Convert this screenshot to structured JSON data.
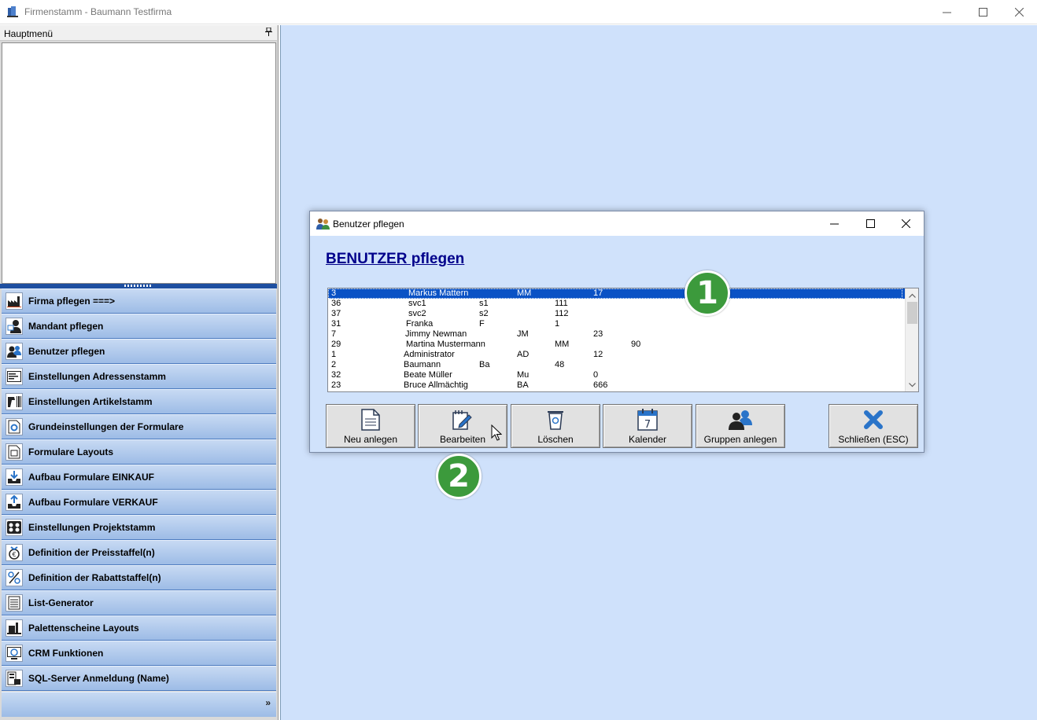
{
  "window": {
    "title": "Firmenstamm - Baumann Testfirma"
  },
  "left_panel": {
    "header": "Hauptmenü",
    "pin_glyph": "📌",
    "items": [
      {
        "label": "Firma pflegen   ===>",
        "icon": "factory-icon"
      },
      {
        "label": "Mandant pflegen",
        "icon": "person-dark-icon"
      },
      {
        "label": "Benutzer pflegen",
        "icon": "users-icon"
      },
      {
        "label": "Einstellungen Adressenstamm",
        "icon": "address-card-icon"
      },
      {
        "label": "Einstellungen Artikelstamm",
        "icon": "scanner-icon"
      },
      {
        "label": "Grundeinstellungen der Formulare",
        "icon": "form-settings-icon"
      },
      {
        "label": "Formulare Layouts",
        "icon": "layout-icon"
      },
      {
        "label": "Aufbau Formulare EINKAUF",
        "icon": "inbox-download-icon"
      },
      {
        "label": "Aufbau Formulare VERKAUF",
        "icon": "inbox-upload-icon"
      },
      {
        "label": "Einstellungen Projektstamm",
        "icon": "project-icon"
      },
      {
        "label": "Definition der Preisstaffel(n)",
        "icon": "price-tag-icon"
      },
      {
        "label": "Definition der Rabattstaffel(n)",
        "icon": "discount-icon"
      },
      {
        "label": "List-Generator",
        "icon": "list-icon"
      },
      {
        "label": "Palettenscheine Layouts",
        "icon": "pallet-icon"
      },
      {
        "label": "CRM Funktionen",
        "icon": "crm-icon"
      },
      {
        "label": "SQL-Server Anmeldung (Name)",
        "icon": "sql-server-icon"
      }
    ],
    "footer_chevron": "»"
  },
  "dialog": {
    "title": "Benutzer pflegen",
    "heading": "BENUTZER pflegen",
    "rows": [
      {
        "id": "3",
        "name": "Markus Mattern",
        "short": "",
        "kz": "MM",
        "num": "17",
        "extra": "",
        "selected": true
      },
      {
        "id": "36",
        "name": "svc1",
        "short": "s1",
        "kz": "",
        "num": "111",
        "extra": ""
      },
      {
        "id": "37",
        "name": "svc2",
        "short": "s2",
        "kz": "",
        "num": "112",
        "extra": ""
      },
      {
        "id": "31",
        "name": "Franka",
        "short": "F",
        "kz": "",
        "num": "1",
        "extra": ""
      },
      {
        "id": "7",
        "name": "Jimmy Newman",
        "short": "",
        "kz": "JM",
        "num": "23",
        "extra": ""
      },
      {
        "id": "29",
        "name": "Martina Mustermann",
        "short": "",
        "kz": "",
        "num": "MM",
        "extra": "90"
      },
      {
        "id": "1",
        "name": "Administrator",
        "short": "",
        "kz": "AD",
        "num": "12",
        "extra": ""
      },
      {
        "id": "2",
        "name": "Baumann",
        "short": "Ba",
        "kz": "",
        "num": "48",
        "extra": ""
      },
      {
        "id": "32",
        "name": "Beate Müller",
        "short": "",
        "kz": "Mu",
        "num": "0",
        "extra": ""
      },
      {
        "id": "23",
        "name": "Bruce Allmächtig",
        "short": "",
        "kz": "BA",
        "num": "666",
        "extra": ""
      }
    ],
    "buttons": {
      "new": "Neu anlegen",
      "edit": "Bearbeiten",
      "delete": "Löschen",
      "calendar": "Kalender",
      "calendar_day": "7",
      "groups": "Gruppen anlegen",
      "close": "Schließen (ESC)"
    }
  },
  "annotations": {
    "badge1": "1",
    "badge2": "2"
  },
  "colors": {
    "workspace": "#cfe1fb",
    "selection": "#0a52c5",
    "heading": "#00008b",
    "badge": "#3c9a3c",
    "close_x": "#2a74c9"
  }
}
